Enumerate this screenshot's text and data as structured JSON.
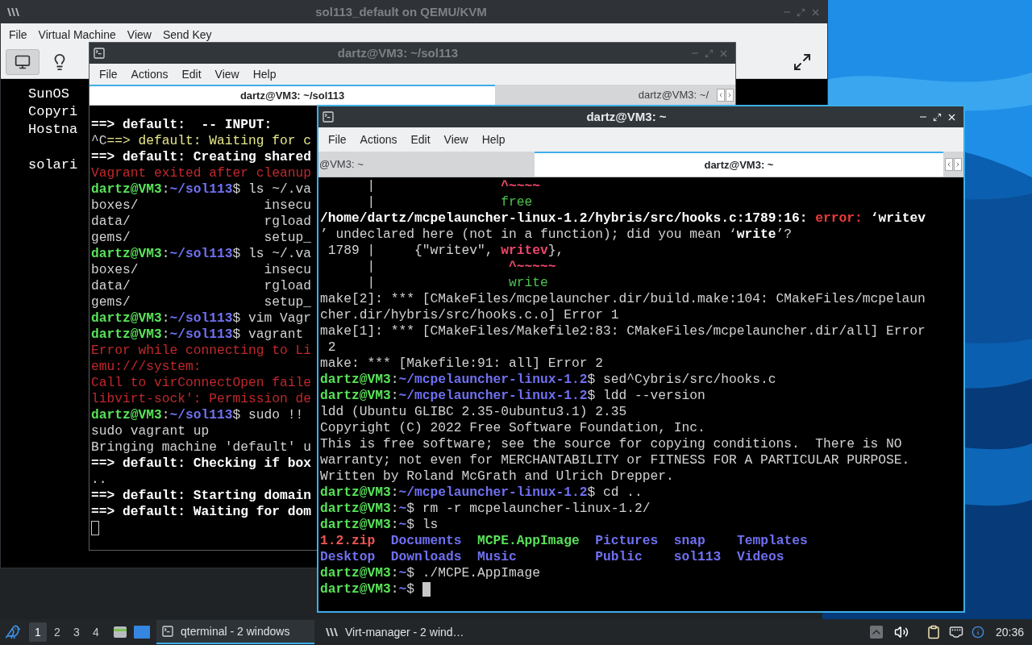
{
  "virt_manager": {
    "title": "sol113_default on QEMU/KVM",
    "active": false,
    "menu": [
      "File",
      "Virtual Machine",
      "View",
      "Send Key"
    ],
    "console_text": "SunOS\nCopyri\nHostna\n\nsolari"
  },
  "terminal_back": {
    "title": "dartz@VM3: ~/sol113",
    "active": false,
    "menu": [
      "File",
      "Actions",
      "Edit",
      "View",
      "Help"
    ],
    "tabs": [
      {
        "label": "dartz@VM3: ~/sol113",
        "selected": true
      },
      {
        "label": "dartz@VM3: ~/",
        "selected": false
      }
    ],
    "lines": [
      [
        {
          "text": "==> default:  -- INPUT:",
          "kind": "bold"
        }
      ],
      [
        {
          "text": "^C",
          "kind": "plain"
        },
        {
          "text": "==> default: Waiting for c",
          "kind": "yellow"
        }
      ],
      [
        {
          "text": "==> default: Creating shared",
          "kind": "bold"
        }
      ],
      [
        {
          "text": "Vagrant exited after cleanup",
          "kind": "red"
        }
      ],
      [
        {
          "text": "dartz@VM3",
          "kind": "user"
        },
        {
          "text": ":",
          "kind": "plain"
        },
        {
          "text": "~/sol113",
          "kind": "path"
        },
        {
          "text": "$ ls ~/.va",
          "kind": "plain"
        }
      ],
      [
        {
          "text": "boxes/                insecu",
          "kind": "plain"
        }
      ],
      [
        {
          "text": "data/                 rgload",
          "kind": "plain"
        }
      ],
      [
        {
          "text": "gems/                 setup_",
          "kind": "plain"
        }
      ],
      [
        {
          "text": "dartz@VM3",
          "kind": "user"
        },
        {
          "text": ":",
          "kind": "plain"
        },
        {
          "text": "~/sol113",
          "kind": "path"
        },
        {
          "text": "$ ls ~/.va",
          "kind": "plain"
        }
      ],
      [
        {
          "text": "boxes/                insecu",
          "kind": "plain"
        }
      ],
      [
        {
          "text": "data/                 rgload",
          "kind": "plain"
        }
      ],
      [
        {
          "text": "gems/                 setup_",
          "kind": "plain"
        }
      ],
      [
        {
          "text": "dartz@VM3",
          "kind": "user"
        },
        {
          "text": ":",
          "kind": "plain"
        },
        {
          "text": "~/sol113",
          "kind": "path"
        },
        {
          "text": "$ vim Vagr",
          "kind": "plain"
        }
      ],
      [
        {
          "text": "dartz@VM3",
          "kind": "user"
        },
        {
          "text": ":",
          "kind": "plain"
        },
        {
          "text": "~/sol113",
          "kind": "path"
        },
        {
          "text": "$ vagrant",
          "kind": "plain"
        }
      ],
      [
        {
          "text": "Error while connecting to Li",
          "kind": "red"
        }
      ],
      [
        {
          "text": "emu:///system:",
          "kind": "red"
        }
      ],
      [
        {
          "text": "Call to virConnectOpen faile",
          "kind": "red"
        }
      ],
      [
        {
          "text": "libvirt-sock': Permission de",
          "kind": "red"
        }
      ],
      [
        {
          "text": "dartz@VM3",
          "kind": "user"
        },
        {
          "text": ":",
          "kind": "plain"
        },
        {
          "text": "~/sol113",
          "kind": "path"
        },
        {
          "text": "$ sudo !!",
          "kind": "plain"
        }
      ],
      [
        {
          "text": "sudo vagrant up",
          "kind": "plain"
        }
      ],
      [
        {
          "text": "Bringing machine 'default' u",
          "kind": "plain"
        }
      ],
      [
        {
          "text": "==> default: Checking if box",
          "kind": "bold"
        }
      ],
      [
        {
          "text": "..",
          "kind": "plain"
        }
      ],
      [
        {
          "text": "==> default: Starting domain",
          "kind": "bold"
        }
      ],
      [
        {
          "text": "==> default: Waiting for dom",
          "kind": "bold"
        }
      ],
      [
        {
          "kind": "cursor_hollow"
        }
      ]
    ]
  },
  "terminal_front": {
    "title": "dartz@VM3: ~",
    "active": true,
    "menu": [
      "File",
      "Actions",
      "Edit",
      "View",
      "Help"
    ],
    "tabs": [
      {
        "label": "@VM3: ~",
        "selected": false
      },
      {
        "label": "dartz@VM3: ~",
        "selected": true
      }
    ],
    "lines": [
      [
        {
          "text": "      |                ",
          "kind": "plain"
        },
        {
          "text": "^~~~~",
          "kind": "caret"
        }
      ],
      [
        {
          "text": "      |                ",
          "kind": "plain"
        },
        {
          "text": "free",
          "kind": "hint"
        }
      ],
      [
        {
          "text": "/home/dartz/mcpelauncher-linux-1.2/hybris/src/hooks.c:1789:16:",
          "kind": "bold"
        },
        {
          "text": " error: ",
          "kind": "err"
        },
        {
          "text": "‘writev",
          "kind": "bold"
        }
      ],
      [
        {
          "text": "’ undeclared here (not in a function); did you mean ‘",
          "kind": "plain"
        },
        {
          "text": "write",
          "kind": "bold"
        },
        {
          "text": "’?",
          "kind": "plain"
        }
      ],
      [
        {
          "text": " 1789 |     {\"writev\", ",
          "kind": "plain"
        },
        {
          "text": "writev",
          "kind": "caret"
        },
        {
          "text": "},",
          "kind": "plain"
        }
      ],
      [
        {
          "text": "      |                 ",
          "kind": "plain"
        },
        {
          "text": "^~~~~~",
          "kind": "caret"
        }
      ],
      [
        {
          "text": "      |                 ",
          "kind": "plain"
        },
        {
          "text": "write",
          "kind": "hint"
        }
      ],
      [
        {
          "text": "make[2]: *** [CMakeFiles/mcpelauncher.dir/build.make:104: CMakeFiles/mcpelaun",
          "kind": "plain"
        }
      ],
      [
        {
          "text": "cher.dir/hybris/src/hooks.c.o] Error 1",
          "kind": "plain"
        }
      ],
      [
        {
          "text": "make[1]: *** [CMakeFiles/Makefile2:83: CMakeFiles/mcpelauncher.dir/all] Error",
          "kind": "plain"
        }
      ],
      [
        {
          "text": " 2",
          "kind": "plain"
        }
      ],
      [
        {
          "text": "make: *** [Makefile:91: all] Error 2",
          "kind": "plain"
        }
      ],
      [
        {
          "text": "dartz@VM3",
          "kind": "user"
        },
        {
          "text": ":",
          "kind": "plain"
        },
        {
          "text": "~/mcpelauncher-linux-1.2",
          "kind": "path"
        },
        {
          "text": "$ sed^Cybris/src/hooks.c",
          "kind": "plain"
        }
      ],
      [
        {
          "text": "dartz@VM3",
          "kind": "user"
        },
        {
          "text": ":",
          "kind": "plain"
        },
        {
          "text": "~/mcpelauncher-linux-1.2",
          "kind": "path"
        },
        {
          "text": "$ ldd --version",
          "kind": "plain"
        }
      ],
      [
        {
          "text": "ldd (Ubuntu GLIBC 2.35-0ubuntu3.1) 2.35",
          "kind": "plain"
        }
      ],
      [
        {
          "text": "Copyright (C) 2022 Free Software Foundation, Inc.",
          "kind": "plain"
        }
      ],
      [
        {
          "text": "This is free software; see the source for copying conditions.  There is NO",
          "kind": "plain"
        }
      ],
      [
        {
          "text": "warranty; not even for MERCHANTABILITY or FITNESS FOR A PARTICULAR PURPOSE.",
          "kind": "plain"
        }
      ],
      [
        {
          "text": "Written by Roland McGrath and Ulrich Drepper.",
          "kind": "plain"
        }
      ],
      [
        {
          "text": "dartz@VM3",
          "kind": "user"
        },
        {
          "text": ":",
          "kind": "plain"
        },
        {
          "text": "~/mcpelauncher-linux-1.2",
          "kind": "path"
        },
        {
          "text": "$ cd ..",
          "kind": "plain"
        }
      ],
      [
        {
          "text": "dartz@VM3",
          "kind": "user"
        },
        {
          "text": ":",
          "kind": "plain"
        },
        {
          "text": "~",
          "kind": "path"
        },
        {
          "text": "$ rm -r mcpelauncher-linux-1.2/",
          "kind": "plain"
        }
      ],
      [
        {
          "text": "dartz@VM3",
          "kind": "user"
        },
        {
          "text": ":",
          "kind": "plain"
        },
        {
          "text": "~",
          "kind": "path"
        },
        {
          "text": "$ ls",
          "kind": "plain"
        }
      ],
      [
        {
          "text": "1.2.zip  ",
          "kind": "archive"
        },
        {
          "text": "Documents  ",
          "kind": "path"
        },
        {
          "text": "MCPE.AppImage  ",
          "kind": "user"
        },
        {
          "text": "Pictures  ",
          "kind": "path"
        },
        {
          "text": "snap    ",
          "kind": "path"
        },
        {
          "text": "Templates",
          "kind": "path"
        }
      ],
      [
        {
          "text": "Desktop  ",
          "kind": "path"
        },
        {
          "text": "Downloads  ",
          "kind": "path"
        },
        {
          "text": "Music          ",
          "kind": "path"
        },
        {
          "text": "Public    ",
          "kind": "path"
        },
        {
          "text": "sol113  ",
          "kind": "path"
        },
        {
          "text": "Videos",
          "kind": "path"
        }
      ],
      [
        {
          "text": "dartz@VM3",
          "kind": "user"
        },
        {
          "text": ":",
          "kind": "plain"
        },
        {
          "text": "~",
          "kind": "path"
        },
        {
          "text": "$ ./MCPE.AppImage",
          "kind": "plain"
        }
      ],
      [
        {
          "text": "dartz@VM3",
          "kind": "user"
        },
        {
          "text": ":",
          "kind": "plain"
        },
        {
          "text": "~",
          "kind": "path"
        },
        {
          "text": "$ ",
          "kind": "plain"
        },
        {
          "kind": "cursor_block"
        }
      ]
    ]
  },
  "taskbar": {
    "workspaces": [
      {
        "label": "1",
        "selected": true
      },
      {
        "label": "2",
        "selected": false
      },
      {
        "label": "3",
        "selected": false
      },
      {
        "label": "4",
        "selected": false
      }
    ],
    "tasks": [
      {
        "label": "qterminal - 2 windows",
        "kind": "terminal",
        "selected": true
      },
      {
        "label": "Virt-manager - 2 wind…",
        "kind": "virt",
        "selected": false
      }
    ],
    "clock": "20:36"
  }
}
